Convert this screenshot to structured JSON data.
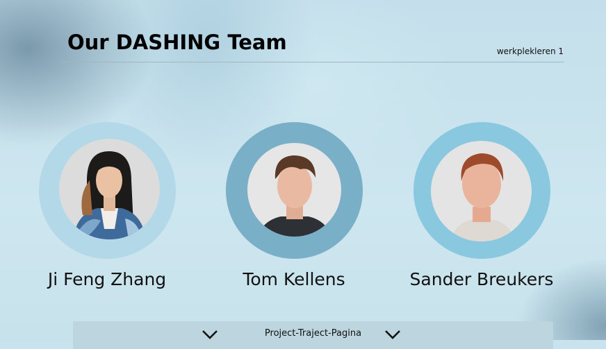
{
  "header": {
    "title": "Our DASHING Team",
    "subtitle": "werkplekleren 1"
  },
  "team": {
    "members": [
      {
        "name": "Ji Feng Zhang",
        "ring_color": "#b3d8e7"
      },
      {
        "name": "Tom Kellens",
        "ring_color": "#7aafc8"
      },
      {
        "name": "Sander Breukers",
        "ring_color": "#8ac8df"
      }
    ]
  },
  "footer": {
    "label": "Project-Traject-Pagina",
    "icons": [
      "chevron-down-icon",
      "chevron-down-icon"
    ]
  }
}
